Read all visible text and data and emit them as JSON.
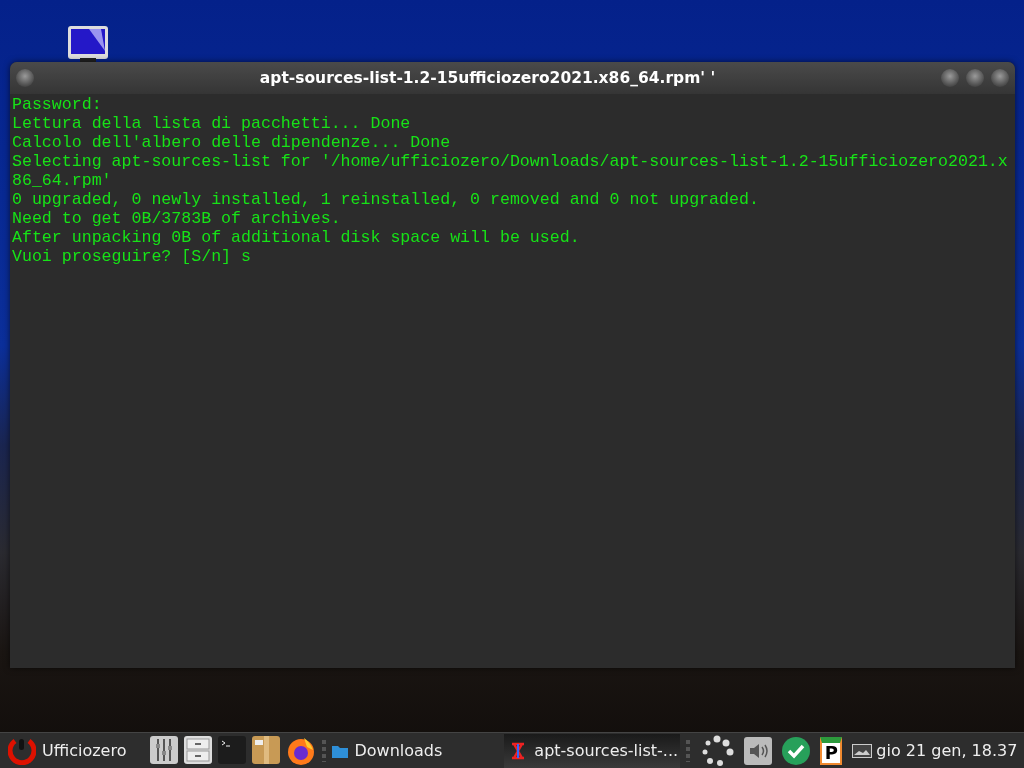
{
  "window": {
    "title": "apt-sources-list-1.2-15ufficiozero2021.x86_64.rpm' '",
    "lines": [
      "Password:",
      "Lettura della lista di pacchetti... Done",
      "Calcolo dell'albero delle dipendenze... Done",
      "Selecting apt-sources-list for '/home/ufficiozero/Downloads/apt-sources-list-1.2-15ufficiozero2021.x",
      "86_64.rpm'",
      "0 upgraded, 0 newly installed, 1 reinstalled, 0 removed and 0 not upgraded.",
      "Need to get 0B/3783B of archives.",
      "After unpacking 0B of additional disk space will be used.",
      "Vuoi proseguire? [S/n] s"
    ]
  },
  "taskbar": {
    "menu_label": "Ufficiozero",
    "places_label": "Downloads",
    "tasks": [
      {
        "label": "apt-sources-list-...",
        "selected": true
      }
    ],
    "clipboard_letter": "P",
    "clock": "gio 21 gen, 18.37"
  }
}
